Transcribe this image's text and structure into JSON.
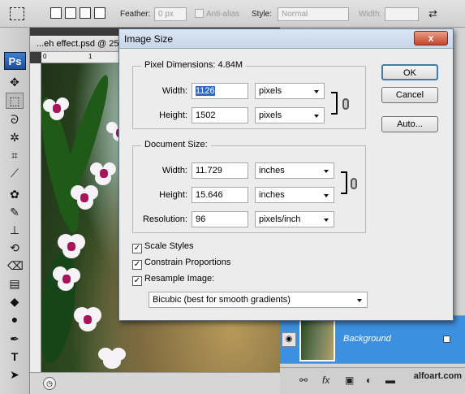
{
  "options_bar": {
    "feather_label": "Feather:",
    "feather_value": "0 px",
    "anti_alias_label": "Anti-alias",
    "style_label": "Style:",
    "style_value": "Normal",
    "width_label": "Width:"
  },
  "toolbar": {
    "logo": "Ps"
  },
  "document": {
    "tab_title": "...eh effect.psd @ 25",
    "ruler_zero": "0",
    "ruler_one": "1"
  },
  "layers": {
    "layer_name": "Background",
    "watermark": "alfoart.com"
  },
  "dialog": {
    "title": "Image Size",
    "close_label": "x",
    "pixel_dimensions": {
      "legend": "Pixel Dimensions:",
      "size": "4.84M",
      "width_label": "Width:",
      "width_value": "1126",
      "width_unit": "pixels",
      "height_label": "Height:",
      "height_value": "1502",
      "height_unit": "pixels"
    },
    "document_size": {
      "legend": "Document Size:",
      "width_label": "Width:",
      "width_value": "11.729",
      "width_unit": "inches",
      "height_label": "Height:",
      "height_value": "15.646",
      "height_unit": "inches",
      "resolution_label": "Resolution:",
      "resolution_value": "96",
      "resolution_unit": "pixels/inch"
    },
    "options": {
      "scale_styles": "Scale Styles",
      "constrain_proportions": "Constrain Proportions",
      "resample_image": "Resample Image:",
      "scale_styles_checked": true,
      "constrain_checked": true,
      "resample_checked": true,
      "resample_method": "Bicubic (best for smooth gradients)"
    },
    "buttons": {
      "ok": "OK",
      "cancel": "Cancel",
      "auto": "Auto..."
    }
  }
}
